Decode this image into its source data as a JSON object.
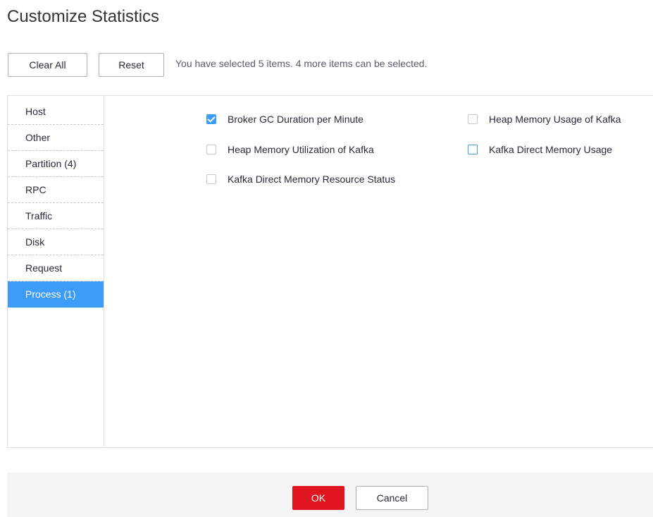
{
  "dialog": {
    "title": "Customize Statistics"
  },
  "toolbar": {
    "clear_all_label": "Clear All",
    "reset_label": "Reset",
    "selection_info": "You have selected 5 items. 4 more items can be selected."
  },
  "categories": [
    {
      "label": "Host",
      "selected": false
    },
    {
      "label": "Other",
      "selected": false
    },
    {
      "label": "Partition (4)",
      "selected": false
    },
    {
      "label": "RPC",
      "selected": false
    },
    {
      "label": "Traffic",
      "selected": false
    },
    {
      "label": "Disk",
      "selected": false
    },
    {
      "label": "Request",
      "selected": false
    },
    {
      "label": "Process (1)",
      "selected": true
    }
  ],
  "metrics": [
    {
      "label": "Broker GC Duration per Minute",
      "checked": true
    },
    {
      "label": "Heap Memory Usage of Kafka",
      "checked": false
    },
    {
      "label": "Heap Memory Utilization of Kafka",
      "checked": false
    },
    {
      "label": "Kafka Direct Memory Usage",
      "checked": false
    },
    {
      "label": "Kafka Direct Memory Resource Status",
      "checked": false
    }
  ],
  "footer": {
    "ok_label": "OK",
    "cancel_label": "Cancel"
  },
  "colors": {
    "accent": "#3d9cf7",
    "primary_button": "#e0151f",
    "footer_background": "#f5f5f6"
  }
}
